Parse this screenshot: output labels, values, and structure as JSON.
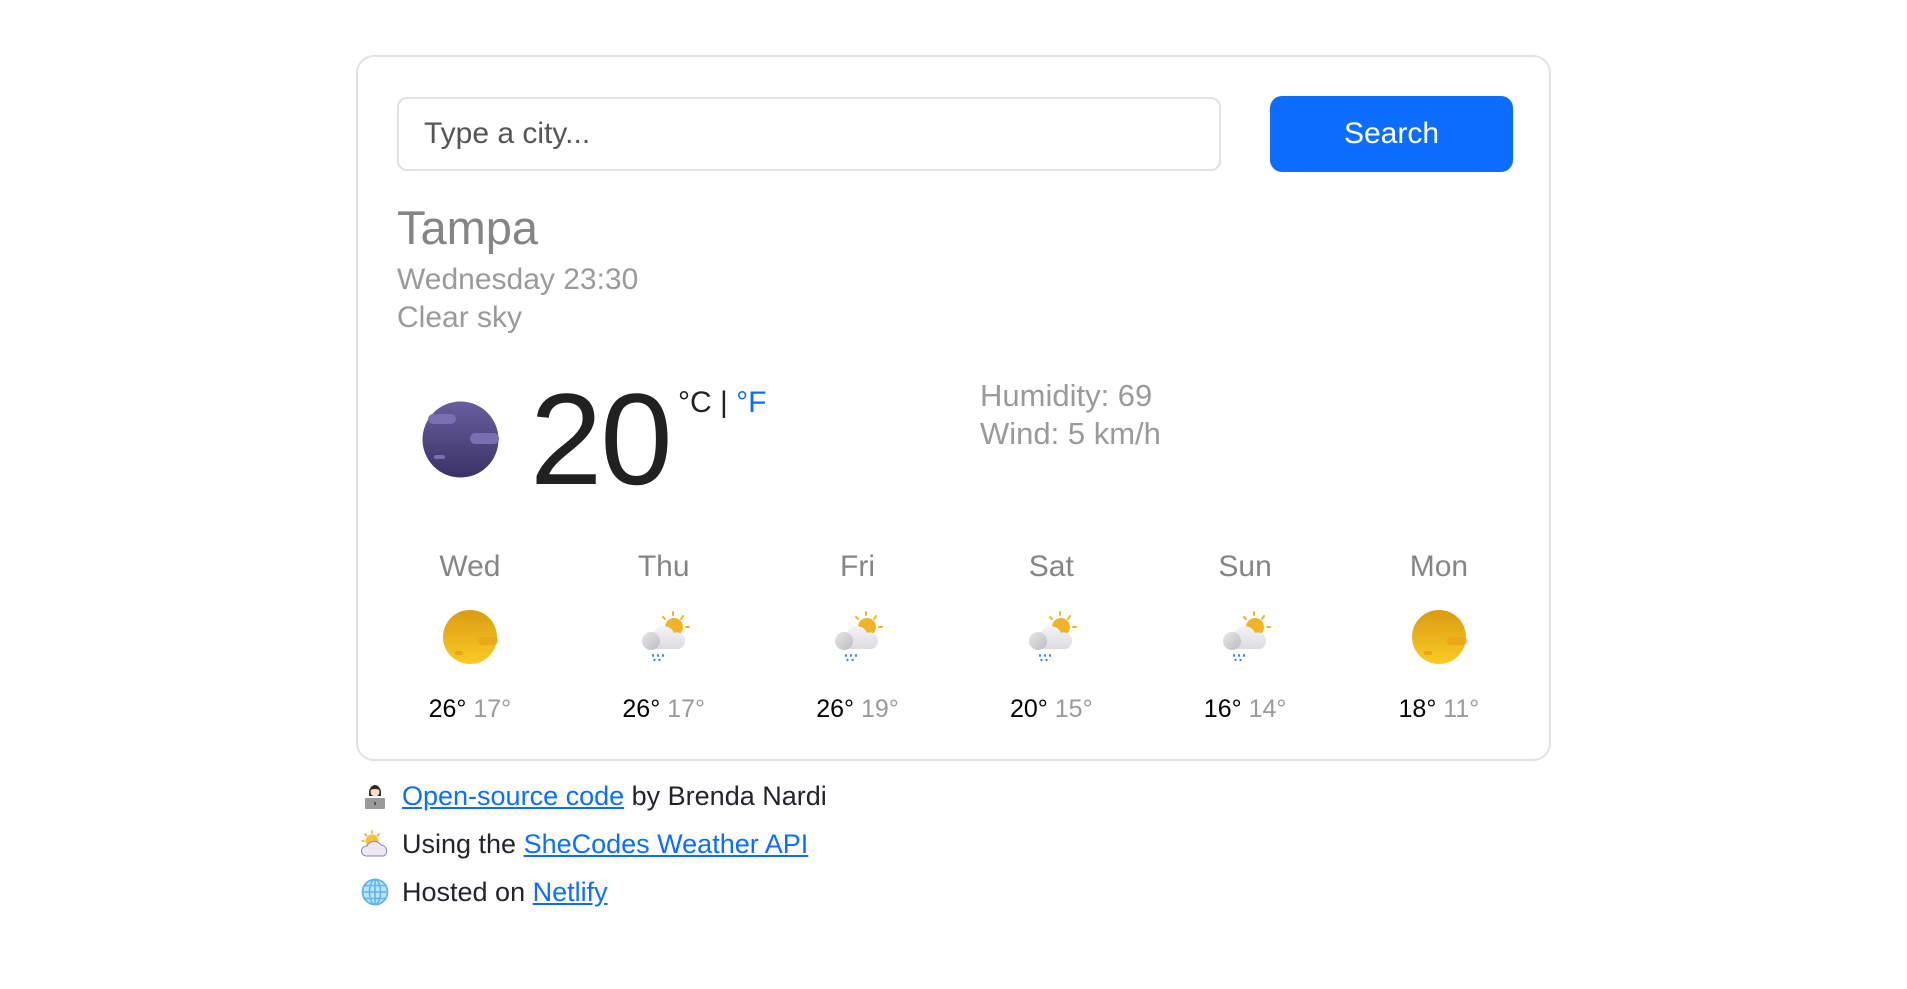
{
  "search": {
    "placeholder": "Type a city...",
    "value": "",
    "button_label": "Search"
  },
  "current": {
    "city": "Tampa",
    "datetime": "Wednesday 23:30",
    "description": "Clear sky",
    "icon": "clear-sky-night-icon",
    "temperature": "20",
    "unit_celsius": "°C",
    "unit_separator": " | ",
    "unit_fahrenheit": "°F",
    "humidity_label": "Humidity: 69",
    "wind_label": "Wind: 5 km/h"
  },
  "forecast": [
    {
      "day": "Wed",
      "icon": "clear-sky-day-icon",
      "max": "26°",
      "min": "17°"
    },
    {
      "day": "Thu",
      "icon": "rain-day-icon",
      "max": "26°",
      "min": "17°"
    },
    {
      "day": "Fri",
      "icon": "rain-day-icon",
      "max": "26°",
      "min": "19°"
    },
    {
      "day": "Sat",
      "icon": "rain-day-icon",
      "max": "20°",
      "min": "15°"
    },
    {
      "day": "Sun",
      "icon": "rain-day-icon",
      "max": "16°",
      "min": "14°"
    },
    {
      "day": "Mon",
      "icon": "clear-sky-day-icon",
      "max": "18°",
      "min": "11°"
    }
  ],
  "footer": {
    "line1": {
      "emoji": "woman-technologist-icon",
      "link": "Open-source code",
      "text": " by Brenda Nardi"
    },
    "line2": {
      "emoji": "sun-behind-cloud-icon",
      "prefix": "Using the ",
      "link": "SheCodes Weather API"
    },
    "line3": {
      "emoji": "globe-icon",
      "prefix": "Hosted on ",
      "link": "Netlify"
    }
  },
  "colors": {
    "accent": "#0d6efd",
    "muted_text": "#9a9a9a",
    "card_border": "#dee2e6"
  }
}
